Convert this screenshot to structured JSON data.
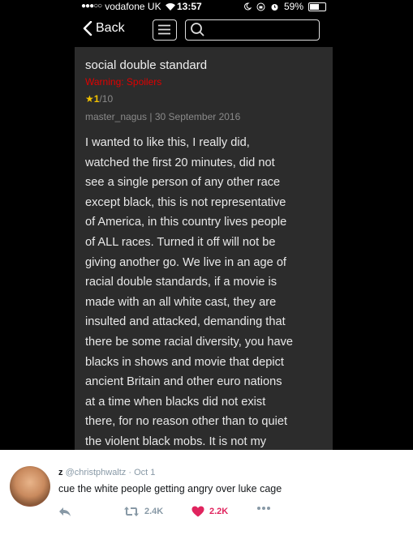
{
  "status": {
    "carrier": "vodafone UK",
    "time": "13:57",
    "battery": "59%"
  },
  "nav": {
    "back_label": "Back",
    "menu_icon": "hamburger-menu-icon",
    "search_icon": "search-icon"
  },
  "review": {
    "title": "social double standard",
    "warning": "Warning: Spoilers",
    "rating_score": "1",
    "rating_max": "/10",
    "author": "master_nagus",
    "separator": "|",
    "date": "30 September 2016",
    "body": "I wanted to like this, I really did,\nwatched the first 20 minutes, did not\nsee a single person of any other race\nexcept black, this is not representative\nof America, in this country lives people\nof ALL races. Turned it off will not be\ngiving another go. We live in an age of\nracial double standards, if a movie is\nmade with an all white cast, they are\ninsulted and attacked, demanding that\nthere be some racial diversity, you have\nblacks in shows and movie that depict\nancient Britain and other euro nations\nat a time when blacks did not exist\nthere, for no reason other than to quiet\nthe violent black mobs. It is not my"
  },
  "tweet": {
    "name": "z",
    "handle": "@christphwaltz",
    "dot": "·",
    "date": "Oct 1",
    "text": "cue the white people getting angry over luke cage",
    "retweets": "2.4K",
    "likes": "2.2K"
  },
  "colors": {
    "accent_red": "#e0245e",
    "warning_red": "#e00000",
    "star_yellow": "#f2c200"
  }
}
